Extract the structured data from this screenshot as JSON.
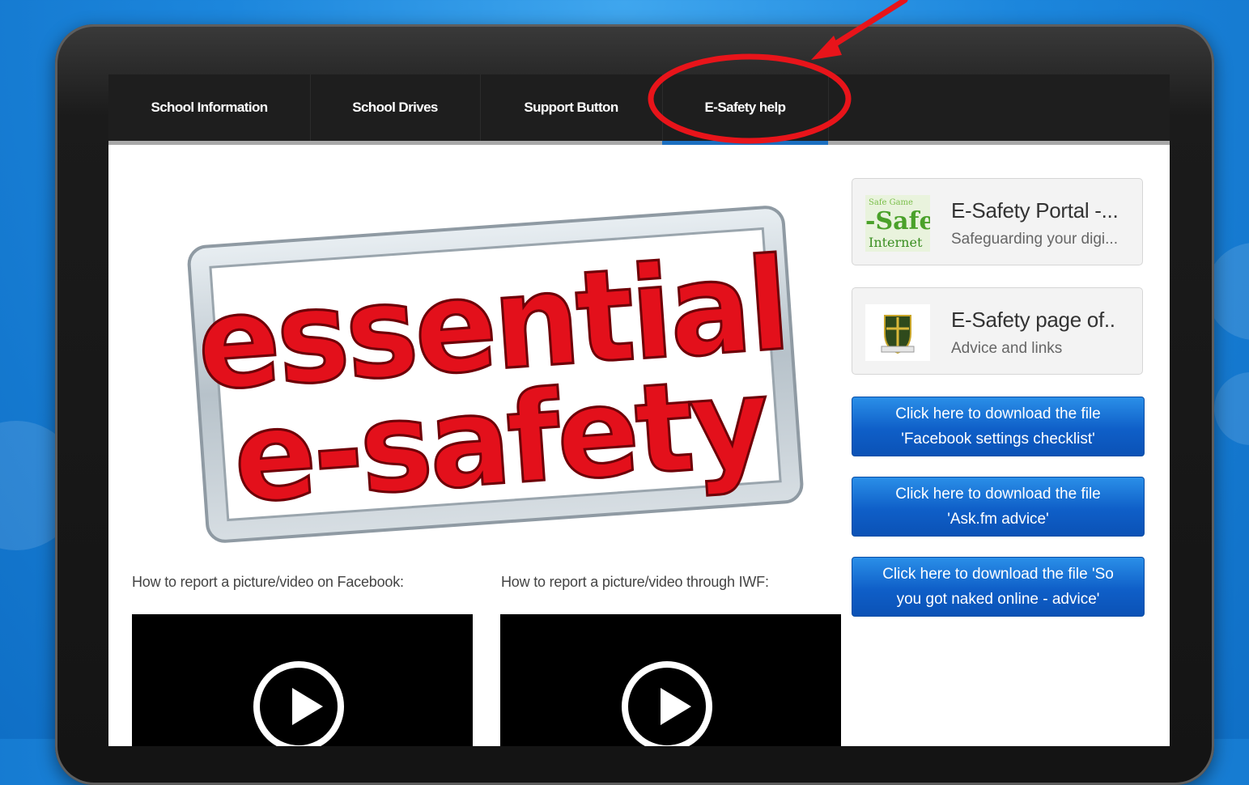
{
  "nav": {
    "items": [
      {
        "label": "School Information"
      },
      {
        "label": "School Drives"
      },
      {
        "label": "Support Button"
      },
      {
        "label": "E-Safety help",
        "active": true
      }
    ]
  },
  "hero": {
    "line1": "essential",
    "line2": "e-safety"
  },
  "videos": [
    {
      "caption": "How to report a picture/video on Facebook:"
    },
    {
      "caption": "How to report a picture/video through IWF:"
    }
  ],
  "sidebar": {
    "cards": [
      {
        "title": "E-Safety Portal -...",
        "subtitle": "Safeguarding your digi...",
        "thumb_text": [
          "-Safet",
          "Internet"
        ]
      },
      {
        "title": "E-Safety page of..",
        "subtitle": "Advice and links"
      }
    ],
    "downloads": [
      {
        "line1": "Click here to download the file",
        "line2": "'Facebook settings checklist'"
      },
      {
        "line1": "Click here to download the file",
        "line2": "'Ask.fm advice'"
      },
      {
        "line1": "Click here to download the file 'So",
        "line2": "you got naked online - advice'"
      }
    ]
  },
  "colors": {
    "accent": "#1b6fc0",
    "nav_bg": "#1e1e1e",
    "annotation": "#e8141a",
    "hero_text": "#e3101b"
  }
}
